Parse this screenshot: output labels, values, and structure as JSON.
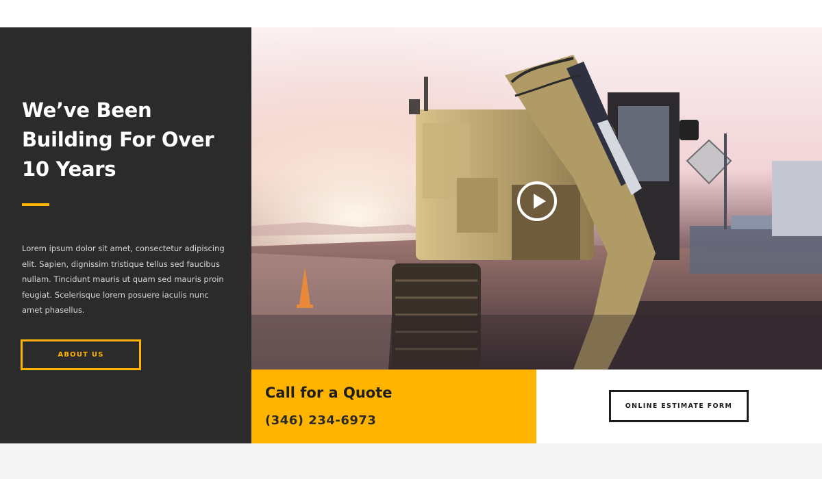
{
  "intro": {
    "heading_line1": "We’ve Been",
    "heading_line2": "Building For Over",
    "heading_line3": "10 Years",
    "paragraph": "Lorem ipsum dolor sit amet, consectetur adipiscing elit. Sapien, dignissim tristique tellus sed faucibus nullam. Tincidunt mauris ut quam sed mauris proin feugiat. Scelerisque lorem posuere iaculis nunc amet phasellus.",
    "about_button": "ABOUT US"
  },
  "hero": {
    "image": "excavator-at-sunset",
    "play_icon": "play-icon"
  },
  "quote": {
    "title": "Call for a Quote",
    "phone": "(346) 234-6973"
  },
  "estimate": {
    "button": "ONLINE ESTIMATE FORM"
  },
  "colors": {
    "accent": "#ffb400",
    "dark_panel": "#2b2b2b",
    "text_dark": "#1e1e1e"
  }
}
